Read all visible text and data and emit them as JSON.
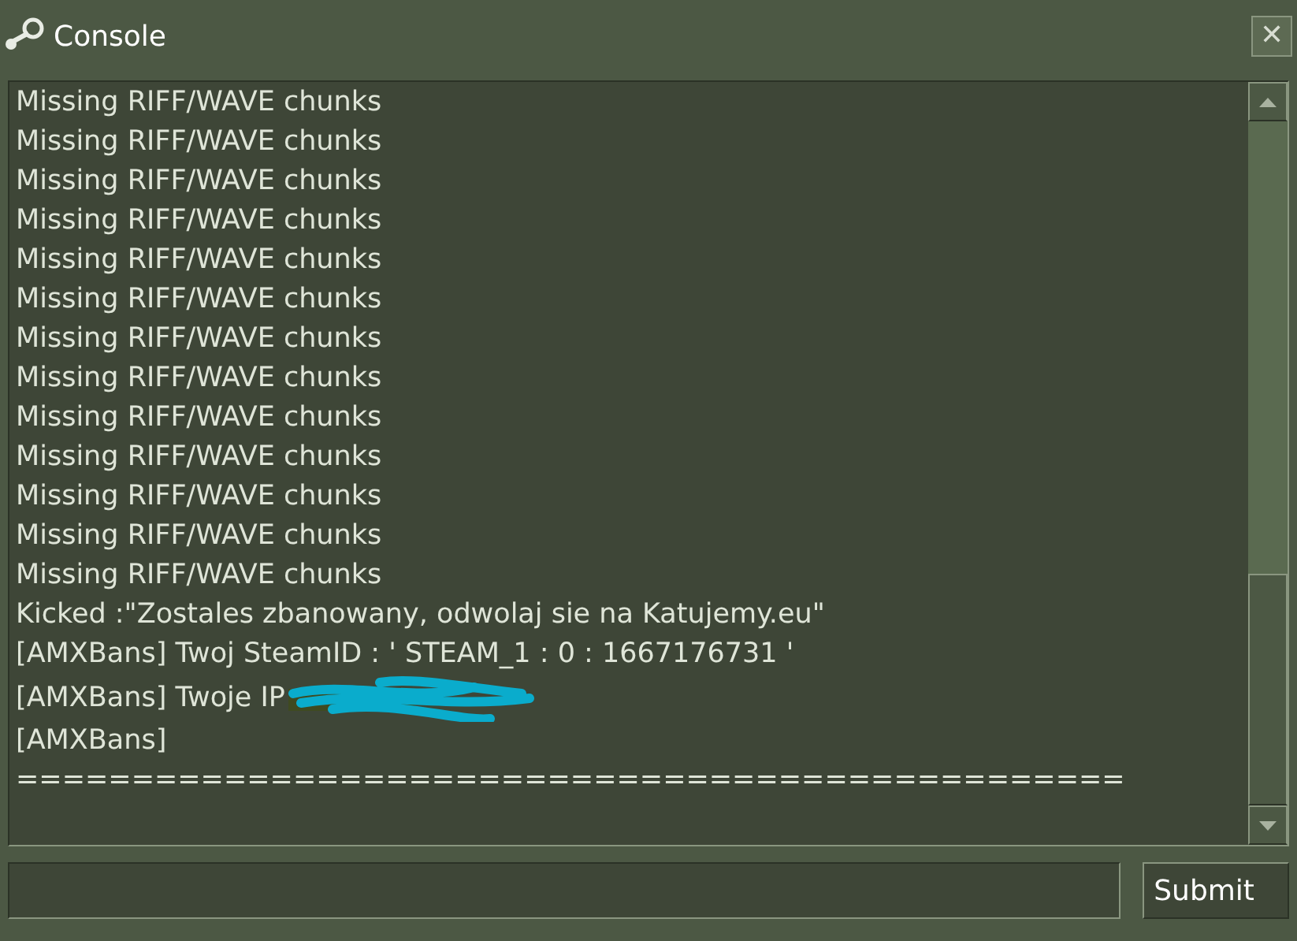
{
  "window": {
    "title": "Console",
    "close": "✕"
  },
  "log": {
    "lines": [
      {
        "kind": "text",
        "text": "Missing RIFF/WAVE chunks"
      },
      {
        "kind": "text",
        "text": "Missing RIFF/WAVE chunks"
      },
      {
        "kind": "text",
        "text": "Missing RIFF/WAVE chunks"
      },
      {
        "kind": "text",
        "text": "Missing RIFF/WAVE chunks"
      },
      {
        "kind": "text",
        "text": "Missing RIFF/WAVE chunks"
      },
      {
        "kind": "text",
        "text": "Missing RIFF/WAVE chunks"
      },
      {
        "kind": "text",
        "text": "Missing RIFF/WAVE chunks"
      },
      {
        "kind": "text",
        "text": "Missing RIFF/WAVE chunks"
      },
      {
        "kind": "text",
        "text": "Missing RIFF/WAVE chunks"
      },
      {
        "kind": "text",
        "text": "Missing RIFF/WAVE chunks"
      },
      {
        "kind": "text",
        "text": "Missing RIFF/WAVE chunks"
      },
      {
        "kind": "text",
        "text": "Missing RIFF/WAVE chunks"
      },
      {
        "kind": "text",
        "text": "Missing RIFF/WAVE chunks"
      },
      {
        "kind": "text",
        "text": "Kicked :\"Zostales zbanowany, odwolaj sie na Katujemy.eu\""
      },
      {
        "kind": "text",
        "text": "[AMXBans] Twoj SteamID : ' STEAM_1 : 0 : 1667176731 '"
      },
      {
        "kind": "redacted",
        "text": "[AMXBans] Twoje IP"
      },
      {
        "kind": "text",
        "text": "[AMXBans]"
      },
      {
        "kind": "text",
        "text": "================================================"
      }
    ]
  },
  "submit": {
    "label": "Submit"
  }
}
